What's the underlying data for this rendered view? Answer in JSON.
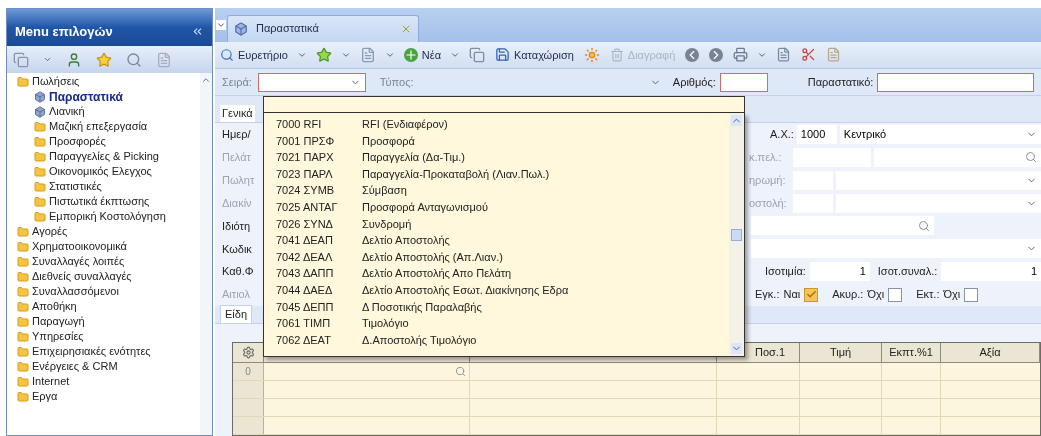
{
  "sidebar": {
    "title": "Menu επιλογών",
    "items": [
      {
        "label": "Πωλήσεις",
        "kind": "folder",
        "selected": false,
        "children": [
          {
            "label": "Παραστατικά",
            "kind": "module",
            "selected": true
          },
          {
            "label": "Λιανική",
            "kind": "module",
            "selected": false
          },
          {
            "label": "Μαζική επεξεργασία",
            "kind": "folder",
            "selected": false
          },
          {
            "label": "Προσφορές",
            "kind": "folder",
            "selected": false
          },
          {
            "label": "Παραγγελίες & Picking",
            "kind": "folder",
            "selected": false
          },
          {
            "label": "Οικονομικός Ελεγχος",
            "kind": "folder",
            "selected": false
          },
          {
            "label": "Στατιστικές",
            "kind": "folder",
            "selected": false
          },
          {
            "label": "Πιστωτικά έκπτωσης",
            "kind": "folder",
            "selected": false
          },
          {
            "label": "Εμπορική Κοστολόγηση",
            "kind": "folder",
            "selected": false
          }
        ]
      },
      {
        "label": "Αγορές",
        "kind": "folder",
        "selected": false
      },
      {
        "label": "Χρηματοοικονομικά",
        "kind": "folder",
        "selected": false
      },
      {
        "label": "Συναλλαγές λοιπές",
        "kind": "folder",
        "selected": false
      },
      {
        "label": "Διεθνείς συναλλαγές",
        "kind": "folder",
        "selected": false
      },
      {
        "label": "Συναλλασσόμενοι",
        "kind": "folder",
        "selected": false
      },
      {
        "label": "Αποθήκη",
        "kind": "folder",
        "selected": false
      },
      {
        "label": "Παραγωγή",
        "kind": "folder",
        "selected": false
      },
      {
        "label": "Υπηρεσίες",
        "kind": "folder",
        "selected": false
      },
      {
        "label": "Επιχειρησιακές ενότητες",
        "kind": "folder",
        "selected": false
      },
      {
        "label": "Ενέργειες & CRM",
        "kind": "folder",
        "selected": false
      },
      {
        "label": "Internet",
        "kind": "folder",
        "selected": false
      },
      {
        "label": "Εργα",
        "kind": "folder",
        "selected": false
      }
    ]
  },
  "tab": {
    "title": "Παραστατικά"
  },
  "toolbar": {
    "index_label": "Ευρετήριο",
    "new_label": "Νέα",
    "save_label": "Καταχώριση",
    "delete": {
      "label": "Διαγραφή",
      "disabled": true
    }
  },
  "header_fields": {
    "series_label": "Σειρά:",
    "type_label": "Τύπος:",
    "number_label": "Αριθμός:",
    "document_label": "Παραστατικό:"
  },
  "form_tab": "Γενικά",
  "left_labels": [
    {
      "text": "Ημερ/",
      "dimmed": false
    },
    {
      "text": "Πελάτ",
      "dimmed": true
    },
    {
      "text": "Πωλητ",
      "dimmed": true
    },
    {
      "text": "Διακίν",
      "dimmed": true
    },
    {
      "text": "Ιδιότη",
      "dimmed": false
    },
    {
      "text": "Κωδικ",
      "dimmed": false
    },
    {
      "text": "Καθ.Φ",
      "dimmed": false
    },
    {
      "text": "Αιτιολ",
      "dimmed": true
    }
  ],
  "right_form": {
    "branch": {
      "label": "Α.Χ.:",
      "code": "1000",
      "name": "Κεντρικό"
    },
    "cut_labels": [
      {
        "text": "κ.πελ.:",
        "dimmed": true
      },
      {
        "text": "ηρωμή:",
        "dimmed": true
      },
      {
        "text": "οστολή:",
        "dimmed": true
      }
    ],
    "rate": {
      "label": "Ισοτιμία:",
      "value": "1"
    },
    "trade_rate": {
      "label": "Ισοτ.συναλ.:",
      "value": "1"
    },
    "flags": [
      {
        "label": "Εγκ.:",
        "value": "Ναι",
        "checked": true
      },
      {
        "label": "Ακυρ.:",
        "value": "Όχι",
        "checked": false
      },
      {
        "label": "Εκτ.:",
        "value": "Όχι",
        "checked": false
      }
    ]
  },
  "lines_tab": "Είδη",
  "table": {
    "columns": [
      "Ποσ.1",
      "Τιμή",
      "Εκπτ.%1",
      "Αξία"
    ],
    "rows": [
      {
        "row_number": "0"
      }
    ]
  },
  "dropdown": {
    "options": [
      {
        "code": "7000 RFI",
        "name": "RFI (Ενδιαφέρον)"
      },
      {
        "code": "7001 ΠΡΣΦ",
        "name": "Προσφορά"
      },
      {
        "code": "7021 ΠΑΡΧ",
        "name": "Παραγγελία (Δα-Τιμ.)"
      },
      {
        "code": "7023 ΠΑΡΛ",
        "name": "Παραγγελία-Προκαταβολή (Λιαν.Πωλ.)"
      },
      {
        "code": "7024 ΣΥΜΒ",
        "name": "Σύμβαση"
      },
      {
        "code": "7025 ΑΝΤΑΓ",
        "name": "Προσφορά Ανταγωνισμού"
      },
      {
        "code": "7026 ΣΥΝΔ",
        "name": "Συνδρομή"
      },
      {
        "code": "7041 ΔΕΑΠ",
        "name": "Δελτίο Αποστολής"
      },
      {
        "code": "7042 ΔΕΑΛ",
        "name": "Δελτίο Αποστολής (Απ.Λιαν.)"
      },
      {
        "code": "7043 ΔΑΠΠ",
        "name": "Δελτίο Αποστολής Απο Πελάτη"
      },
      {
        "code": "7044 ΔΑΕΔ",
        "name": "Δελτίο Αποστολής Εσωτ. Διακίνησης Εδρα"
      },
      {
        "code": "7045 ΔΕΠΠ",
        "name": "Δ Ποσοτικής Παραλαβής"
      },
      {
        "code": "7061 ΤΙΜΠ",
        "name": "Τιμολόγιο"
      },
      {
        "code": "7062 ΔΕΑΤ",
        "name": "Δ.Αποστολής Τιμολόγιο"
      }
    ]
  }
}
